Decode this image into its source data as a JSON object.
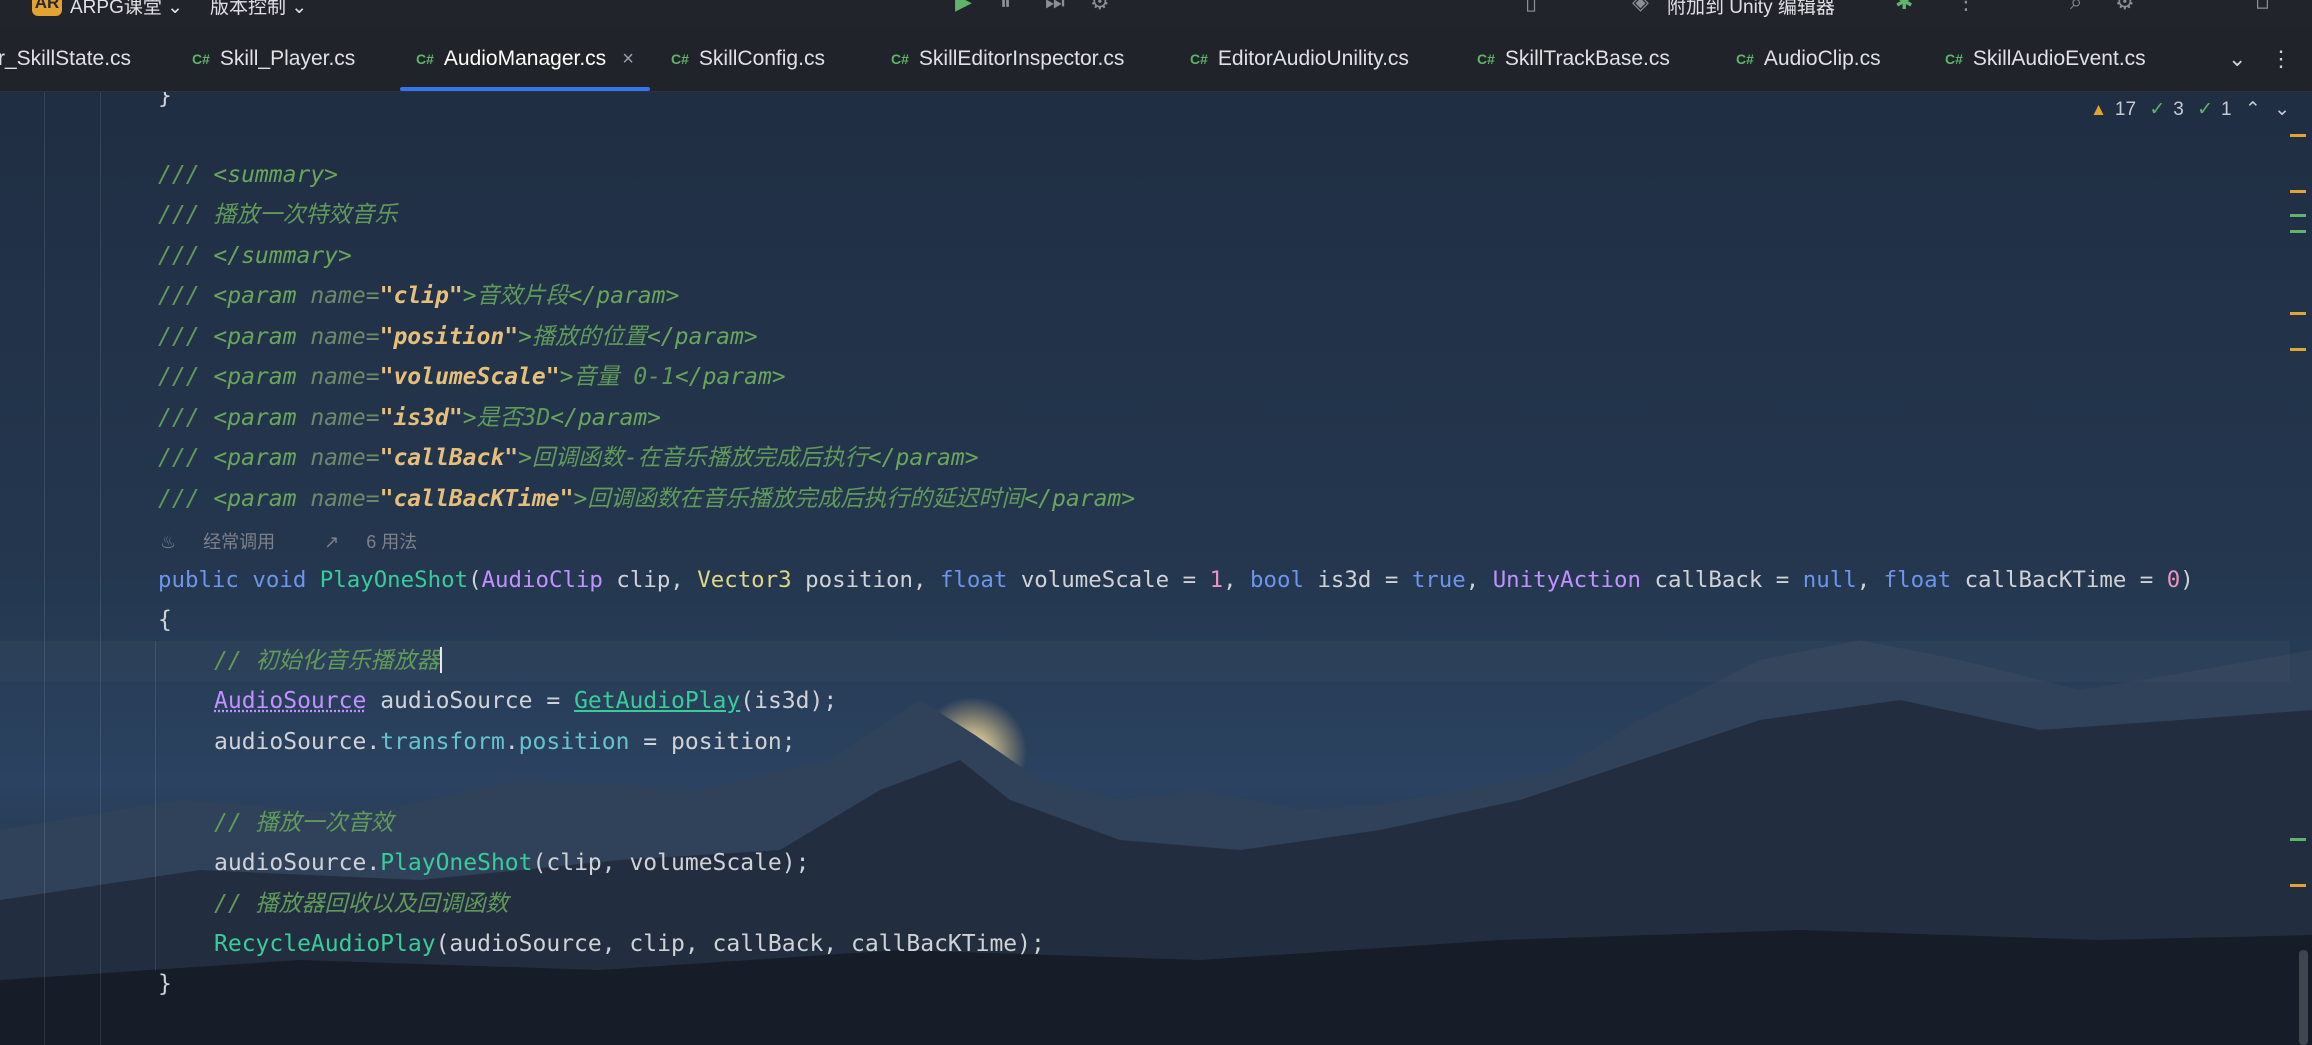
{
  "toolbar": {
    "project_badge": "AR",
    "project_name": "ARPG课堂 ⌄",
    "branch": "版本控制 ⌄",
    "attach_label": "附加到 Unity 编辑器"
  },
  "tabs": [
    {
      "label": "r_SkillState.cs",
      "active": false
    },
    {
      "label": "Skill_Player.cs",
      "active": false
    },
    {
      "label": "AudioManager.cs",
      "active": true
    },
    {
      "label": "SkillConfig.cs",
      "active": false
    },
    {
      "label": "SkillEditorInspector.cs",
      "active": false
    },
    {
      "label": "EditorAudioUnility.cs",
      "active": false
    },
    {
      "label": "SkillTrackBase.cs",
      "active": false
    },
    {
      "label": "AudioClip.cs",
      "active": false
    },
    {
      "label": "SkillAudioEvent.cs",
      "active": false
    }
  ],
  "tab_icon_text": "C#",
  "inspection": {
    "warnings": "17",
    "weak": "3",
    "typos": "1"
  },
  "code_hint": {
    "frequent": "经常调用",
    "usages": "6 用法"
  },
  "code": {
    "brace_top": "}",
    "doc": {
      "summary_open": "<summary>",
      "summary_text": "播放一次特效音乐",
      "summary_close": "</summary>",
      "params": [
        {
          "name": "clip",
          "text": "音效片段"
        },
        {
          "name": "position",
          "text": "播放的位置"
        },
        {
          "name": "volumeScale",
          "text": "音量 0-1"
        },
        {
          "name": "is3d",
          "text": "是否3D"
        },
        {
          "name": "callBack",
          "text": "回调函数-在音乐播放完成后执行"
        },
        {
          "name": "callBacKTime",
          "text": "回调函数在音乐播放完成后执行的延迟时间"
        }
      ]
    },
    "signature": {
      "public": "public",
      "void": "void",
      "method": "PlayOneShot",
      "t1": "AudioClip",
      "p1": "clip",
      "t2": "Vector3",
      "p2": "position",
      "t3": "float",
      "p3": "volumeScale",
      "v3": "1",
      "t4": "bool",
      "p4": "is3d",
      "v4": "true",
      "t5": "UnityAction",
      "p5": "callBack",
      "v5": "null",
      "t6": "float",
      "p6": "callBacKTime",
      "v6": "0"
    },
    "body": {
      "comment1": "// 初始化音乐播放器",
      "l1_type": "AudioSource",
      "l1_var": "audioSource",
      "l1_call": "GetAudioPlay",
      "l1_arg": "is3d",
      "l2_obj": "audioSource",
      "l2_p1": "transform",
      "l2_p2": "position",
      "l2_rhs": "position",
      "comment2": "// 播放一次音效",
      "l3_obj": "audioSource",
      "l3_call": "PlayOneShot",
      "l3_args": "clip, volumeScale",
      "comment3": "// 播放器回收以及回调函数",
      "l4_call": "RecycleAudioPlay",
      "l4_args": "audioSource, clip, callBack, callBacKTime"
    }
  },
  "colors": {
    "accent": "#3574F0",
    "warning": "#E3A234",
    "ok": "#5fb36a"
  }
}
